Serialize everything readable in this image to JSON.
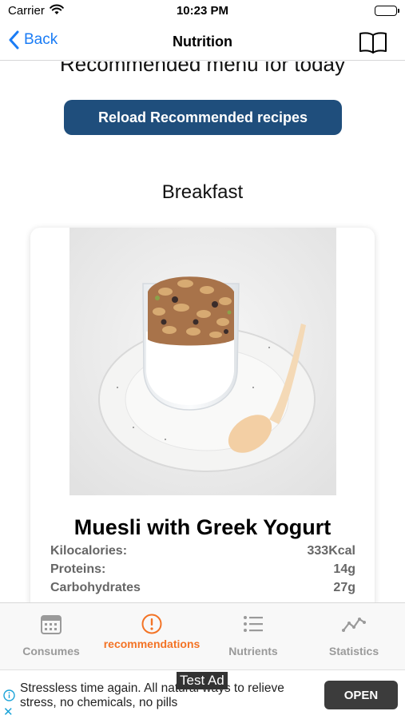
{
  "status_bar": {
    "carrier": "Carrier",
    "time": "10:23 PM"
  },
  "nav": {
    "back_label": "Back",
    "title": "Nutrition",
    "right_icon": "book-icon"
  },
  "content": {
    "section_heading": "Recommended menu for today",
    "reload_button": "Reload Recommended recipes",
    "meal_title": "Breakfast",
    "recipe": {
      "name": "Muesli with Greek Yogurt",
      "nutrients": [
        {
          "label": "Kilocalories:",
          "value": "333Kcal"
        },
        {
          "label": "Proteins:",
          "value": "14g"
        },
        {
          "label": "Carbohydrates",
          "value": "27g"
        }
      ]
    }
  },
  "tab_bar": {
    "tabs": [
      {
        "label": "Consumes",
        "icon": "calendar-icon",
        "active": false
      },
      {
        "label": "recommendations",
        "icon": "exclamation-circle-icon",
        "active": true
      },
      {
        "label": "Nutrients",
        "icon": "list-icon",
        "active": false
      },
      {
        "label": "Statistics",
        "icon": "line-chart-icon",
        "active": false
      }
    ]
  },
  "ad": {
    "text": "Stressless time again. All natural ways to relieve stress, no chemicals, no pills",
    "label": "Test Ad",
    "open_button": "OPEN"
  },
  "colors": {
    "accent_blue": "#1a7cf5",
    "button_navy": "#1f4e7c",
    "active_tab": "#f37325",
    "inactive_tab": "#9a9a9a"
  }
}
